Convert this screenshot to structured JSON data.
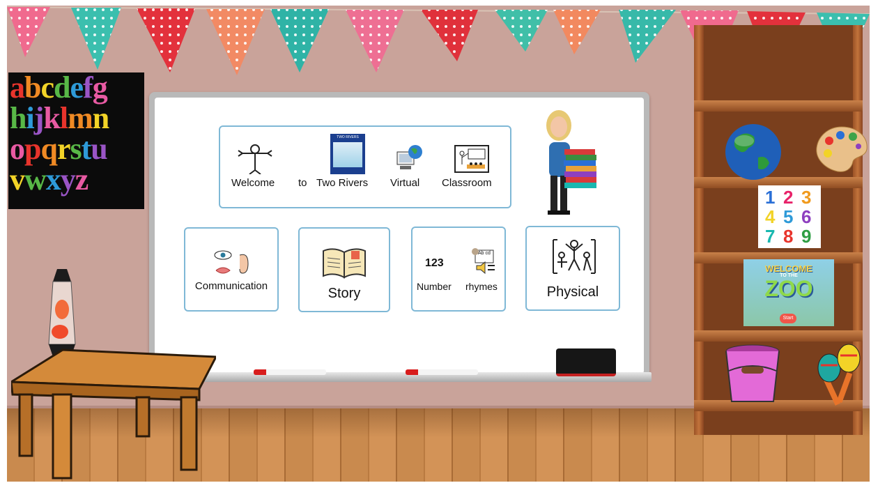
{
  "alphabet_poster": {
    "rows": [
      {
        "letters": "abcdefg"
      },
      {
        "letters": "hijklmn"
      },
      {
        "letters": "opqrstu"
      },
      {
        "letters": "vwxyz"
      }
    ],
    "letter_colors": [
      "#e8342c",
      "#f08a24",
      "#f2d327",
      "#58b847",
      "#2e9ad8",
      "#9a55c6",
      "#e85aa3"
    ]
  },
  "welcome_banner": {
    "words": [
      "Welcome",
      "to",
      "Two Rivers",
      "Virtual",
      "Classroom"
    ],
    "school_logo_text": "TWO RIVERS"
  },
  "activities": [
    {
      "id": "communication",
      "label": "Communication",
      "icon": "eye-ear-mouth-icon"
    },
    {
      "id": "story",
      "label": "Story",
      "icon": "open-book-icon"
    },
    {
      "id": "number-rhymes",
      "number_text": "123",
      "label_left": "Number",
      "label_right": "rhymes",
      "icon": "rhymes-icon",
      "abc_text": "Ab cd"
    },
    {
      "id": "physical",
      "label": "Physical",
      "icon": "physical-activity-icon"
    }
  ],
  "shelf": {
    "number_card": [
      "1",
      "2",
      "3",
      "4",
      "5",
      "6",
      "7",
      "8",
      "9"
    ],
    "number_colors": [
      "#2a6fd6",
      "#e8236a",
      "#f09a1d",
      "#f2d327",
      "#2e9ad8",
      "#8e3fbf",
      "#19b8b0",
      "#e8342c",
      "#2f9e44"
    ],
    "zoo_game": {
      "title_top": "WELCOME",
      "title_mid": "TO THE",
      "title_big": "ZOO",
      "start_label": "Start"
    }
  },
  "colors": {
    "wall": "#c9a39a",
    "card_border": "#7fb8d6",
    "shelf_wood": "#7a3f1d"
  }
}
